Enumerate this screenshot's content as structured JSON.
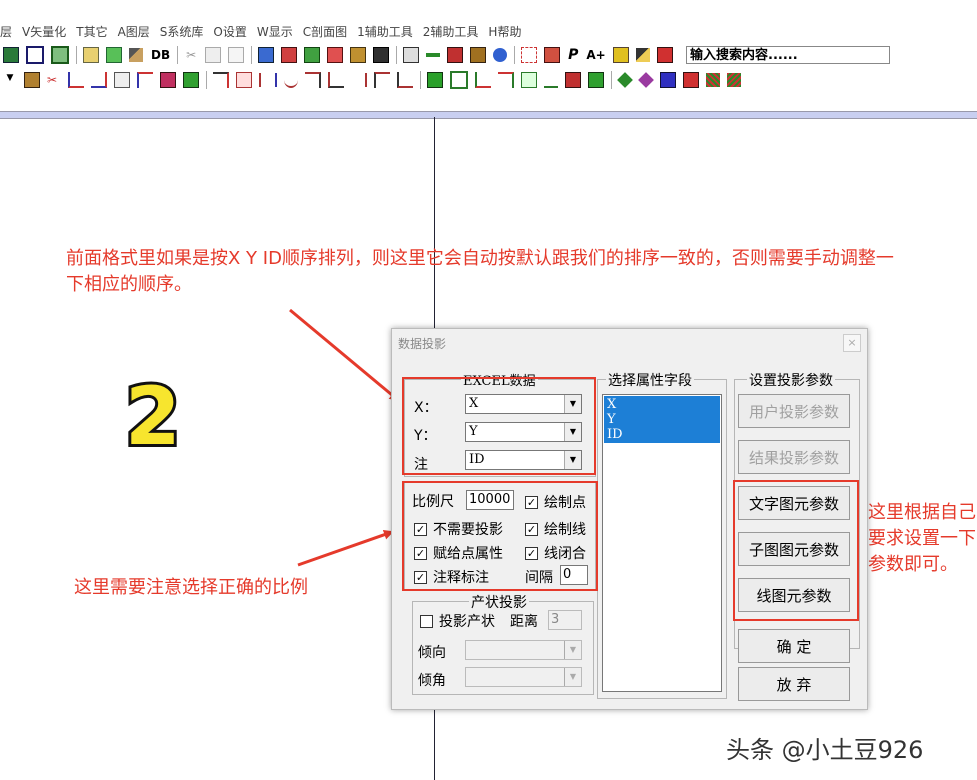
{
  "menu": [
    "层",
    "V矢量化",
    "T其它",
    "A图层",
    "S系统库",
    "O设置",
    "W显示",
    "C剖面图",
    "1辅助工具",
    "2辅助工具",
    "H帮助"
  ],
  "toolbar": {
    "db_label": "DB",
    "p_label": "P",
    "a_plus_label": "A+",
    "search_value": "输入搜索内容......"
  },
  "annotations": {
    "top": "前面格式里如果是按X Y ID顺序排列，则这里它会自动按默认跟我们的排序一致的，否则需要手动调整一下相应的顺序。",
    "left": "这里需要注意选择正确的比例",
    "right": "这里根据自己要求设置一下参数即可。",
    "number": "2"
  },
  "dialog": {
    "title": "数据投影",
    "close": "×",
    "excel": {
      "title": "EXCEL数据",
      "x_label": "X：",
      "x_value": "X",
      "y_label": "Y：",
      "y_value": "Y",
      "note_label": "注",
      "note_value": "ID"
    },
    "options": {
      "scale_label": "比例尺",
      "scale_value": "10000",
      "draw_points": "绘制点",
      "no_projection": "不需要投影",
      "draw_lines": "绘制线",
      "assign_point_attr": "赋给点属性",
      "close_lines": "线闭合",
      "label_annotation": "注释标注",
      "interval_label": "间隔",
      "interval_value": "0",
      "checked": {
        "draw_points": true,
        "no_projection": true,
        "draw_lines": true,
        "assign_point_attr": true,
        "close_lines": true,
        "label_annotation": true
      }
    },
    "occurrence": {
      "title": "产状投影",
      "project_label": "投影产状",
      "distance_label": "距离",
      "distance_value": "3",
      "dip_dir_label": "倾向",
      "dip_angle_label": "倾角"
    },
    "attr_fields": {
      "title": "选择属性字段",
      "items": [
        "X",
        "Y",
        "ID"
      ]
    },
    "projection": {
      "title": "设置投影参数",
      "user_proj": "用户投影参数",
      "result_proj": "结果投影参数",
      "text_elem": "文字图元参数",
      "sub_elem": "子图图元参数",
      "line_elem": "线图元参数",
      "ok": "确  定",
      "cancel": "放  弃"
    }
  },
  "watermark": "头条 @小土豆926",
  "colors": {
    "annotation_red": "#e53a2b",
    "selection_blue": "#1d7fd6",
    "number_yellow": "#f7e52e"
  }
}
